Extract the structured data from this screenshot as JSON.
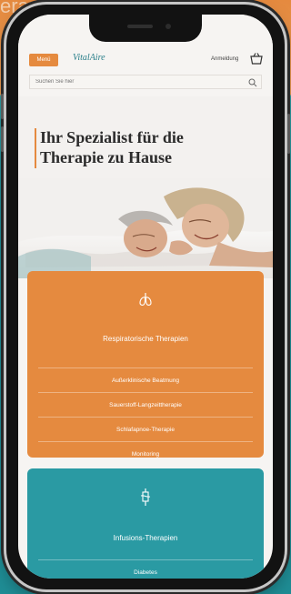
{
  "background": {
    "accent_orange": "#e58a3f",
    "accent_teal": "#2a9aa3",
    "top_text": "erapien"
  },
  "header": {
    "menu_label": "Menü",
    "logo_text": "VitalAire",
    "login_label": "Anmeldung",
    "search_placeholder": "Suchen Sie hier"
  },
  "hero": {
    "title_line1": "Ihr Spezialist für die",
    "title_line2": "Therapie zu Hause"
  },
  "cards": {
    "respiratory": {
      "title": "Respiratorische Therapien",
      "items": [
        "Außerklinische Beatmung",
        "Sauerstoff-Langzeittherapie",
        "Schlafapnoe-Therapie",
        "Monitoring"
      ]
    },
    "infusion": {
      "title": "Infusions-Therapien",
      "items": [
        "Diabetes"
      ]
    }
  }
}
